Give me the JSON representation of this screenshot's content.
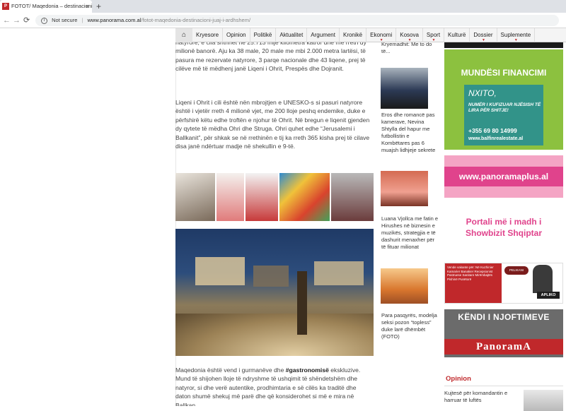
{
  "browser": {
    "tab_title": "FOTOT/ Maqedonia – destinacioni ...",
    "tab_close": "×",
    "new_tab": "+",
    "nav": {
      "back": "←",
      "forward": "→",
      "reload": "⟳"
    },
    "security_label": "Not secure",
    "url_host": "www.panorama.com.al",
    "url_path": "/fotot-maqedonia-destinacioni-juaj-i-ardhshem/"
  },
  "site_nav": {
    "home_icon": "⌂",
    "items": [
      {
        "label": "Kryesore",
        "dropdown": false
      },
      {
        "label": "Opinion",
        "dropdown": false
      },
      {
        "label": "Politikë",
        "dropdown": false
      },
      {
        "label": "Aktualitet",
        "dropdown": false
      },
      {
        "label": "Argument",
        "dropdown": false
      },
      {
        "label": "Kronikë",
        "dropdown": false
      },
      {
        "label": "Ekonomi",
        "dropdown": true
      },
      {
        "label": "Kosova",
        "dropdown": true
      },
      {
        "label": "Sport",
        "dropdown": true
      },
      {
        "label": "Kulturë",
        "dropdown": false
      },
      {
        "label": "Dossier",
        "dropdown": true
      },
      {
        "label": "Suplemente",
        "dropdown": true
      }
    ],
    "caret": "▼"
  },
  "article": {
    "p1": "natyrore, e cila shtrihet në 25.713 mijë kilometra katror dhe me rreth dy milionë banorë. Aju ka 38 male, 20 male me mbi 2.000 metra lartësi, të pasura me rezervate natyrore, 3 parqe nacionale dhe 43 liqene, prej të cilëve më të mëdhenj janë Liqeni i Ohrit, Prespës dhe Dojranit.",
    "p2": "Liqeni i Ohrit i cili është nën mbrojtjen e UNESKO-s si pasuri natyrore është i vjetër rreth 4 milionë vjet, me 200 lloje peshq endemike, duke e përfshirë këtu edhe troftën e njohur të Ohrit. Në bregun e liqenit gjenden dy qytete të mëdha Ohri dhe Struga. Ohri quhet edhe “Jerusalemi i Ballkanit”, për shkak se në rrethinën e tij ka rreth 365 kisha prej të cilave disa janë ndërtuar madje në shekullin e 9-të.",
    "p3_before": "Maqedonia është vend i gurmanëve dhe ",
    "p3_bold": "#gastronomisë",
    "p3_after": " ekskluzive. Mund të shijohen lloje të ndryshme të ushqimit të shëndetshëm dhe natyror, si dhe verë autentike, prodhimtaria e së cilës ka traditë dhe daton shumë shekuj më parë dhe që konsiderohet si më e mira në Ballkan."
  },
  "sidebar": {
    "items": [
      {
        "caption": "Kryemadhit: Me to do të..."
      },
      {
        "caption": "Eros dhe romancë pas kamerave, Nevina Shtylla del hapur me futbollistin e Kombëtares pas 6 muajsh lidhjeje sekrete"
      },
      {
        "caption": "Luana Vjollca me fatin e Hirushes në biznesin e muzikës, strategjia e të dashurit menaxher për të fituar milionat"
      },
      {
        "caption": "Para pasqyrës, modelja seksi pozon “topless” duke larë dhëmbët (FOTO)"
      }
    ]
  },
  "ads": {
    "financimi": {
      "title": "MUNDËSI FINANCIMI",
      "brand": "NXITO,",
      "text": "NUMËR I KUFIZUAR NJËSISH TË LIRA PËR SHITJE!",
      "phone": "+355 69 80 14999",
      "web": "www.balfinrealestate.al"
    },
    "plus": {
      "url": "www.panoramaplus.al",
      "slogan": "Portali më i madh i Showbizit Shqiptar"
    },
    "vakante": {
      "text": "Vende vakante për: Në Kuzhinier Kamarier Banakier Recepsionist Pastruese Sanitare Mirëmbajtës Pishinë Punëtorë",
      "logo": "PELIKANI",
      "apply": "APLIKO"
    },
    "njoftime": {
      "head": "KËNDI I NJOFTIMEVE",
      "brand": "PanoramA"
    }
  },
  "opinion": {
    "title": "Opinion",
    "text": "Kujtesë për komandantin e harruar të luftës"
  },
  "colors": {
    "brand_red": "#c0282b",
    "ad_green": "#8cc13f",
    "ad_pink": "#e0438c"
  }
}
